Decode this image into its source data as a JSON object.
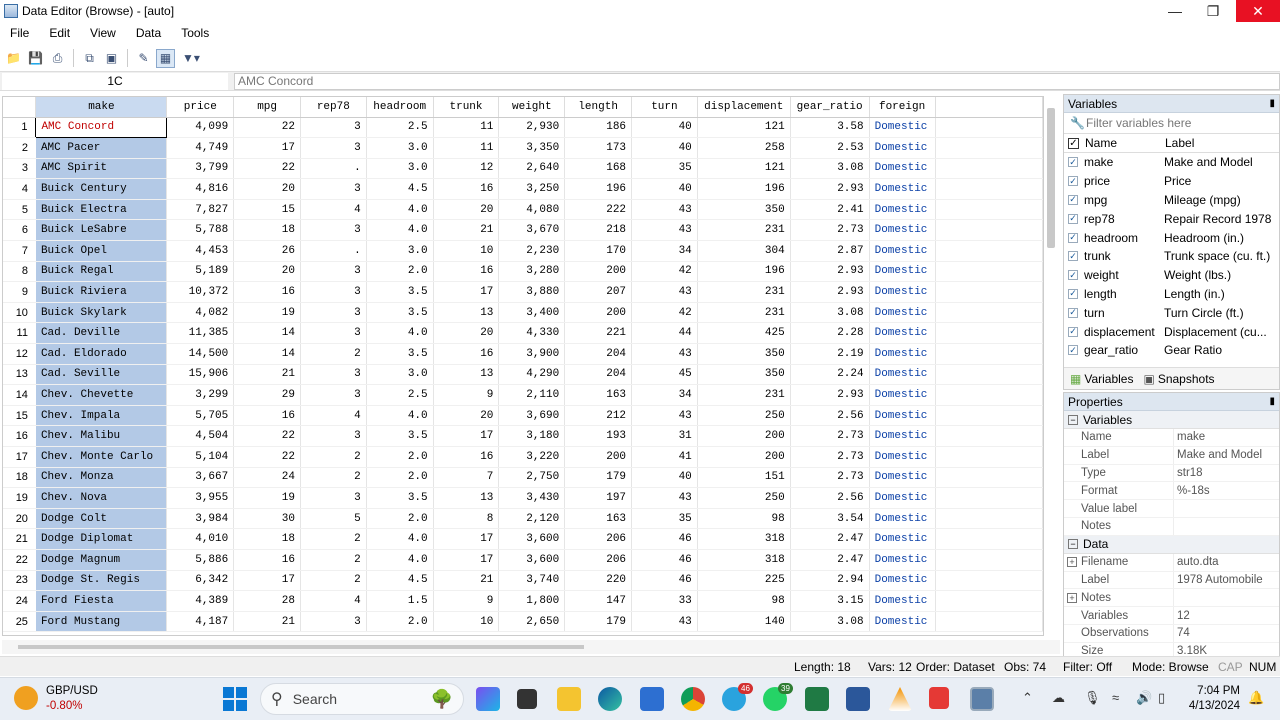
{
  "window": {
    "title": "Data Editor (Browse) - [auto]"
  },
  "menu": [
    "File",
    "Edit",
    "View",
    "Data",
    "Tools"
  ],
  "refbar": {
    "cell": "1C",
    "value": "AMC Concord"
  },
  "columns": [
    "make",
    "price",
    "mpg",
    "rep78",
    "headroom",
    "trunk",
    "weight",
    "length",
    "turn",
    "displacement",
    "gear_ratio",
    "foreign"
  ],
  "rows": [
    [
      "1",
      "AMC Concord",
      "4,099",
      "22",
      "3",
      "2.5",
      "11",
      "2,930",
      "186",
      "40",
      "121",
      "3.58",
      "Domestic"
    ],
    [
      "2",
      "AMC Pacer",
      "4,749",
      "17",
      "3",
      "3.0",
      "11",
      "3,350",
      "173",
      "40",
      "258",
      "2.53",
      "Domestic"
    ],
    [
      "3",
      "AMC Spirit",
      "3,799",
      "22",
      ".",
      "3.0",
      "12",
      "2,640",
      "168",
      "35",
      "121",
      "3.08",
      "Domestic"
    ],
    [
      "4",
      "Buick Century",
      "4,816",
      "20",
      "3",
      "4.5",
      "16",
      "3,250",
      "196",
      "40",
      "196",
      "2.93",
      "Domestic"
    ],
    [
      "5",
      "Buick Electra",
      "7,827",
      "15",
      "4",
      "4.0",
      "20",
      "4,080",
      "222",
      "43",
      "350",
      "2.41",
      "Domestic"
    ],
    [
      "6",
      "Buick LeSabre",
      "5,788",
      "18",
      "3",
      "4.0",
      "21",
      "3,670",
      "218",
      "43",
      "231",
      "2.73",
      "Domestic"
    ],
    [
      "7",
      "Buick Opel",
      "4,453",
      "26",
      ".",
      "3.0",
      "10",
      "2,230",
      "170",
      "34",
      "304",
      "2.87",
      "Domestic"
    ],
    [
      "8",
      "Buick Regal",
      "5,189",
      "20",
      "3",
      "2.0",
      "16",
      "3,280",
      "200",
      "42",
      "196",
      "2.93",
      "Domestic"
    ],
    [
      "9",
      "Buick Riviera",
      "10,372",
      "16",
      "3",
      "3.5",
      "17",
      "3,880",
      "207",
      "43",
      "231",
      "2.93",
      "Domestic"
    ],
    [
      "10",
      "Buick Skylark",
      "4,082",
      "19",
      "3",
      "3.5",
      "13",
      "3,400",
      "200",
      "42",
      "231",
      "3.08",
      "Domestic"
    ],
    [
      "11",
      "Cad. Deville",
      "11,385",
      "14",
      "3",
      "4.0",
      "20",
      "4,330",
      "221",
      "44",
      "425",
      "2.28",
      "Domestic"
    ],
    [
      "12",
      "Cad. Eldorado",
      "14,500",
      "14",
      "2",
      "3.5",
      "16",
      "3,900",
      "204",
      "43",
      "350",
      "2.19",
      "Domestic"
    ],
    [
      "13",
      "Cad. Seville",
      "15,906",
      "21",
      "3",
      "3.0",
      "13",
      "4,290",
      "204",
      "45",
      "350",
      "2.24",
      "Domestic"
    ],
    [
      "14",
      "Chev. Chevette",
      "3,299",
      "29",
      "3",
      "2.5",
      "9",
      "2,110",
      "163",
      "34",
      "231",
      "2.93",
      "Domestic"
    ],
    [
      "15",
      "Chev. Impala",
      "5,705",
      "16",
      "4",
      "4.0",
      "20",
      "3,690",
      "212",
      "43",
      "250",
      "2.56",
      "Domestic"
    ],
    [
      "16",
      "Chev. Malibu",
      "4,504",
      "22",
      "3",
      "3.5",
      "17",
      "3,180",
      "193",
      "31",
      "200",
      "2.73",
      "Domestic"
    ],
    [
      "17",
      "Chev. Monte Carlo",
      "5,104",
      "22",
      "2",
      "2.0",
      "16",
      "3,220",
      "200",
      "41",
      "200",
      "2.73",
      "Domestic"
    ],
    [
      "18",
      "Chev. Monza",
      "3,667",
      "24",
      "2",
      "2.0",
      "7",
      "2,750",
      "179",
      "40",
      "151",
      "2.73",
      "Domestic"
    ],
    [
      "19",
      "Chev. Nova",
      "3,955",
      "19",
      "3",
      "3.5",
      "13",
      "3,430",
      "197",
      "43",
      "250",
      "2.56",
      "Domestic"
    ],
    [
      "20",
      "Dodge Colt",
      "3,984",
      "30",
      "5",
      "2.0",
      "8",
      "2,120",
      "163",
      "35",
      "98",
      "3.54",
      "Domestic"
    ],
    [
      "21",
      "Dodge Diplomat",
      "4,010",
      "18",
      "2",
      "4.0",
      "17",
      "3,600",
      "206",
      "46",
      "318",
      "2.47",
      "Domestic"
    ],
    [
      "22",
      "Dodge Magnum",
      "5,886",
      "16",
      "2",
      "4.0",
      "17",
      "3,600",
      "206",
      "46",
      "318",
      "2.47",
      "Domestic"
    ],
    [
      "23",
      "Dodge St. Regis",
      "6,342",
      "17",
      "2",
      "4.5",
      "21",
      "3,740",
      "220",
      "46",
      "225",
      "2.94",
      "Domestic"
    ],
    [
      "24",
      "Ford Fiesta",
      "4,389",
      "28",
      "4",
      "1.5",
      "9",
      "1,800",
      "147",
      "33",
      "98",
      "3.15",
      "Domestic"
    ],
    [
      "25",
      "Ford Mustang",
      "4,187",
      "21",
      "3",
      "2.0",
      "10",
      "2,650",
      "179",
      "43",
      "140",
      "3.08",
      "Domestic"
    ]
  ],
  "variables": {
    "title": "Variables",
    "filter_placeholder": "Filter variables here",
    "header": {
      "name": "Name",
      "label": "Label"
    },
    "items": [
      {
        "name": "make",
        "label": "Make and Model"
      },
      {
        "name": "price",
        "label": "Price"
      },
      {
        "name": "mpg",
        "label": "Mileage (mpg)"
      },
      {
        "name": "rep78",
        "label": "Repair Record 1978"
      },
      {
        "name": "headroom",
        "label": "Headroom (in.)"
      },
      {
        "name": "trunk",
        "label": "Trunk space (cu. ft.)"
      },
      {
        "name": "weight",
        "label": "Weight (lbs.)"
      },
      {
        "name": "length",
        "label": "Length (in.)"
      },
      {
        "name": "turn",
        "label": "Turn Circle (ft.)"
      },
      {
        "name": "displacement",
        "label": "Displacement (cu..."
      },
      {
        "name": "gear_ratio",
        "label": "Gear Ratio"
      }
    ],
    "tabs": {
      "variables": "Variables",
      "snapshots": "Snapshots"
    }
  },
  "properties": {
    "title": "Properties",
    "group_variables": "Variables",
    "var_rows": [
      {
        "key": "Name",
        "value": "make"
      },
      {
        "key": "Label",
        "value": "Make and Model"
      },
      {
        "key": "Type",
        "value": "str18"
      },
      {
        "key": "Format",
        "value": "%-18s"
      },
      {
        "key": "Value label",
        "value": ""
      },
      {
        "key": "Notes",
        "value": ""
      }
    ],
    "group_data": "Data",
    "data_rows": [
      {
        "key": "Filename",
        "value": "auto.dta"
      },
      {
        "key": "Label",
        "value": "1978 Automobile"
      },
      {
        "key": "Notes",
        "value": ""
      },
      {
        "key": "Variables",
        "value": "12"
      },
      {
        "key": "Observations",
        "value": "74"
      },
      {
        "key": "Size",
        "value": "3.18K"
      }
    ]
  },
  "status": {
    "length": "Length: 18",
    "vars": "Vars: 12",
    "order": "Order: Dataset",
    "obs": "Obs: 74",
    "filter": "Filter: Off",
    "mode": "Mode: Browse",
    "cap": "CAP",
    "num": "NUM"
  },
  "taskbar": {
    "ticker": "GBP/USD",
    "change": "-0.80%",
    "search": "Search",
    "badge_telegram": "46",
    "badge_whatsapp": "39",
    "time": "7:04 PM",
    "date": "4/13/2024"
  }
}
